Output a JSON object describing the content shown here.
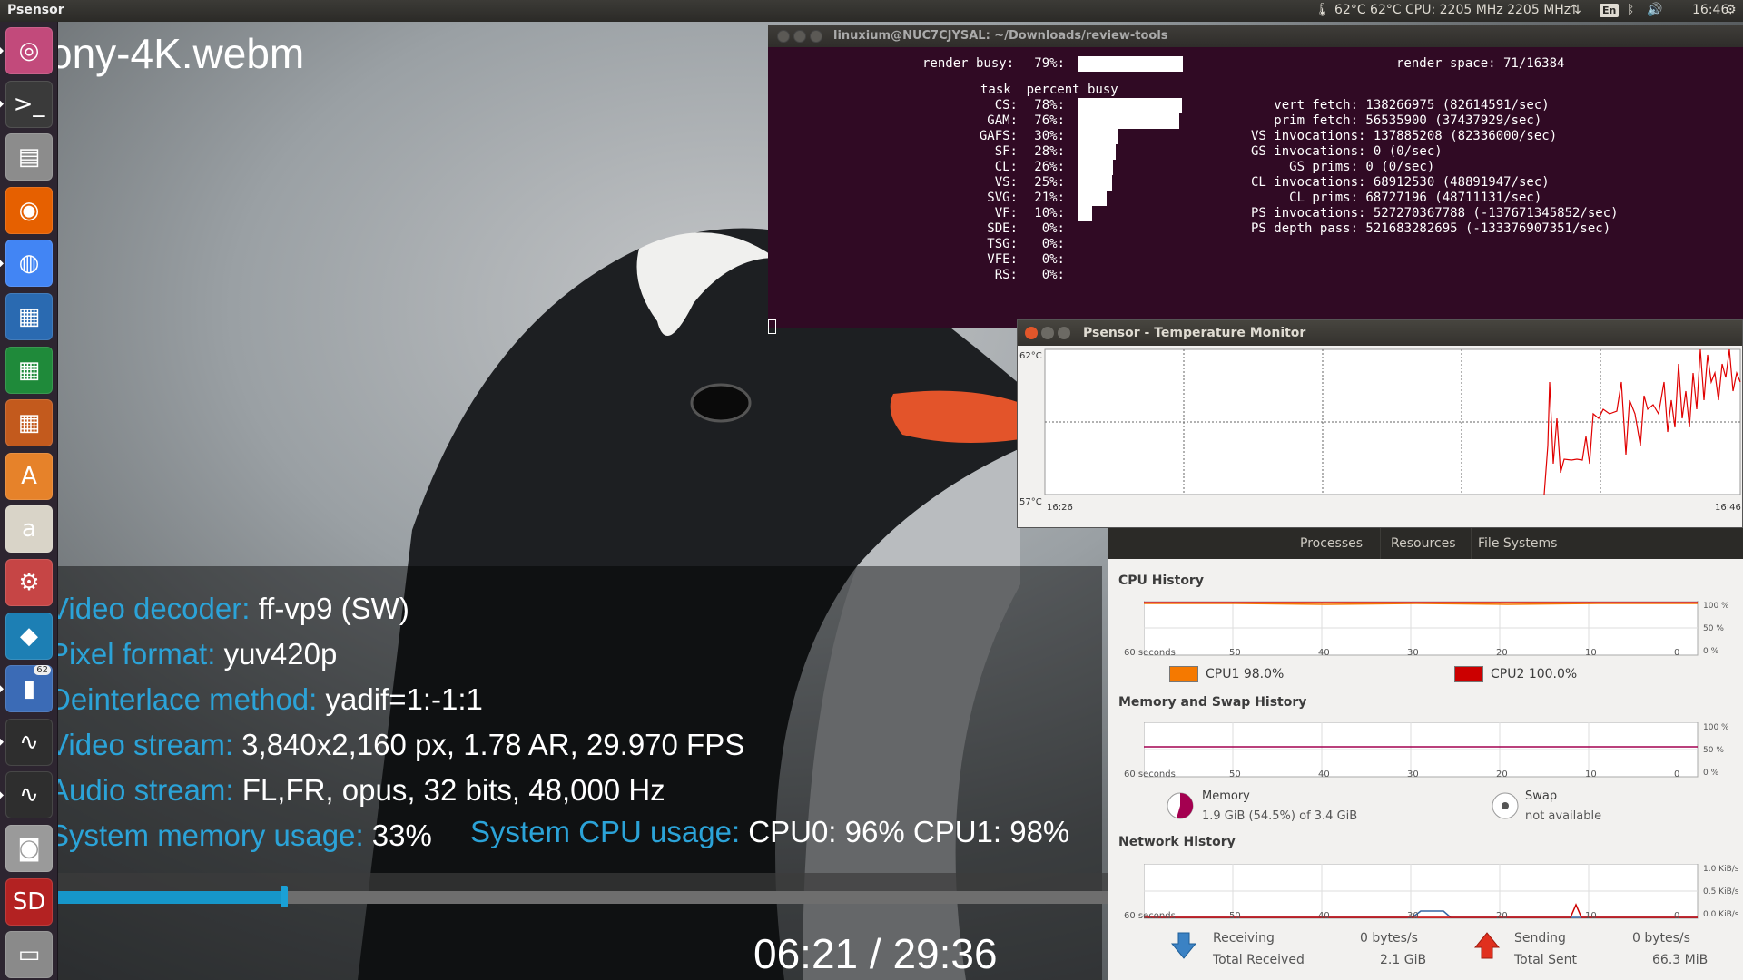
{
  "topbar": {
    "app_name": "Psensor",
    "temps": "62°C 62°C",
    "cpu": "CPU: 2205 MHz 2205 MHz",
    "keyboard": "En",
    "time": "16:46"
  },
  "launcher": {
    "items": [
      {
        "name": "ubuntu-dash",
        "glyph": "◎",
        "color": "#c24a7b"
      },
      {
        "name": "terminal",
        "glyph": ">_",
        "color": "#3a3a3a"
      },
      {
        "name": "files",
        "glyph": "▤",
        "color": "#8c8c8c"
      },
      {
        "name": "firefox",
        "glyph": "◉",
        "color": "#e66000"
      },
      {
        "name": "chrome",
        "glyph": "◍",
        "color": "#4285f4"
      },
      {
        "name": "writer",
        "glyph": "▦",
        "color": "#2a6ab1"
      },
      {
        "name": "calc",
        "glyph": "▦",
        "color": "#1f8a3a"
      },
      {
        "name": "impress",
        "glyph": "▦",
        "color": "#c35a1d"
      },
      {
        "name": "software-center",
        "glyph": "A",
        "color": "#e6822a"
      },
      {
        "name": "amazon",
        "glyph": "a",
        "color": "#d9d4c8"
      },
      {
        "name": "system-settings",
        "glyph": "⚙",
        "color": "#c64545"
      },
      {
        "name": "kodi",
        "glyph": "◆",
        "color": "#1d7fb4"
      },
      {
        "name": "psensor",
        "glyph": "▮",
        "color": "#3b6bb6",
        "badge": "62"
      },
      {
        "name": "system-monitor",
        "glyph": "∿",
        "color": "#2e2e2e"
      },
      {
        "name": "system-monitor-2",
        "glyph": "∿",
        "color": "#2e2e2e"
      },
      {
        "name": "camera",
        "glyph": "◙",
        "color": "#9a9a9a"
      },
      {
        "name": "sd-card",
        "glyph": "SD",
        "color": "#b32222"
      },
      {
        "name": "usb-drive",
        "glyph": "▭",
        "color": "#8a8a8a"
      }
    ]
  },
  "video": {
    "filename": "ony-4K.webm",
    "osd": [
      {
        "key": "Video decoder: ",
        "value": "ff-vp9 (SW)"
      },
      {
        "key": "Pixel format: ",
        "value": "yuv420p"
      },
      {
        "key": "Deinterlace method: ",
        "value": "yadif=1:-1:1"
      },
      {
        "key": "Video stream: ",
        "value": "3,840x2,160 px, 1.78 AR, 29.970 FPS"
      },
      {
        "key": "Audio stream: ",
        "value": "FL,FR, opus, 32 bits, 48,000 Hz"
      },
      {
        "key": "System memory usage: ",
        "value": "33%"
      }
    ],
    "cpu_usage_key": "System CPU usage: ",
    "cpu_usage_value": "CPU0:  96% CPU1:  98%",
    "progress_fraction": 0.215,
    "timecode": "06:21 / 29:36"
  },
  "terminal": {
    "title": "linuxium@NUC7CJYSAL: ~/Downloads/review-tools",
    "render_busy_label": "render busy:",
    "render_busy": "79%:",
    "render_busy_frac": 0.79,
    "render_space": "render space: 71/16384",
    "task_header": "task  percent busy",
    "tasks": [
      {
        "name": "CS:",
        "pct": "78%:",
        "frac": 0.78
      },
      {
        "name": "GAM:",
        "pct": "76%:",
        "frac": 0.76
      },
      {
        "name": "GAFS:",
        "pct": "30%:",
        "frac": 0.3
      },
      {
        "name": "SF:",
        "pct": "28%:",
        "frac": 0.28
      },
      {
        "name": "CL:",
        "pct": "26%:",
        "frac": 0.26
      },
      {
        "name": "VS:",
        "pct": "25%:",
        "frac": 0.25
      },
      {
        "name": "SVG:",
        "pct": "21%:",
        "frac": 0.21
      },
      {
        "name": "VF:",
        "pct": "10%:",
        "frac": 0.1
      },
      {
        "name": "SDE:",
        "pct": "0%:",
        "frac": 0
      },
      {
        "name": "TSG:",
        "pct": "0%:",
        "frac": 0
      },
      {
        "name": "VFE:",
        "pct": "0%:",
        "frac": 0
      },
      {
        "name": "RS:",
        "pct": "0%:",
        "frac": 0
      }
    ],
    "stats": [
      "   vert fetch: 138266975 (82614591/sec)",
      "   prim fetch: 56535900 (37437929/sec)",
      "VS invocations: 137885208 (82336000/sec)",
      "GS invocations: 0 (0/sec)",
      "     GS prims: 0 (0/sec)",
      "CL invocations: 68912530 (48891947/sec)",
      "     CL prims: 68727196 (48711131/sec)",
      "PS invocations: 527270367788 (-137671345852/sec)",
      "PS depth pass: 521683282695 (-133376907351/sec)"
    ]
  },
  "temp_monitor": {
    "title": "Psensor - Temperature Monitor",
    "y_max": "62°C",
    "y_min": "57°C",
    "x_start": "16:26",
    "x_end": "16:46",
    "line_color": "#e00000"
  },
  "system_monitor": {
    "tabs": [
      "Processes",
      "Resources",
      "File Systems"
    ],
    "cpu_title": "CPU History",
    "mem_title": "Memory and Swap History",
    "net_title": "Network History",
    "x_ticks": [
      "60 seconds",
      "50",
      "40",
      "30",
      "20",
      "10",
      "0"
    ],
    "pct_ticks": [
      "100 %",
      "50 %",
      "0 %"
    ],
    "net_ticks": [
      "1.0 KiB/s",
      "0.5 KiB/s",
      "0.0 KiB/s"
    ],
    "cpu1_label": "CPU1  98.0%",
    "cpu2_label": "CPU2  100.0%",
    "cpu1_color": "#f57900",
    "cpu2_color": "#cc0000",
    "memory_label": "Memory",
    "memory_value": "1.9 GiB (54.5%) of 3.4 GiB",
    "swap_label": "Swap",
    "swap_value": "not available",
    "receiving_label": "Receiving",
    "receiving_value": "0 bytes/s",
    "total_received_label": "Total Received",
    "total_received_value": "2.1 GiB",
    "sending_label": "Sending",
    "sending_value": "0 bytes/s",
    "total_sent_label": "Total Sent",
    "total_sent_value": "66.3 MiB"
  }
}
